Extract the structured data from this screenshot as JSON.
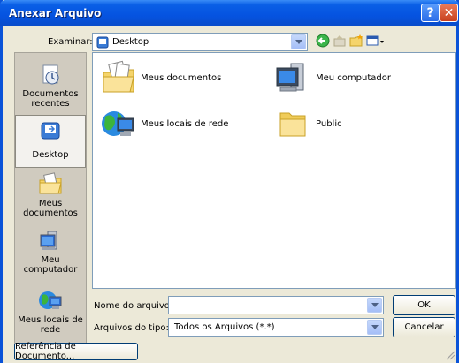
{
  "window": {
    "title": "Anexar Arquivo"
  },
  "look_in": {
    "label": "Examinar:",
    "value": "Desktop"
  },
  "toolbar": {
    "icons": [
      "back-icon",
      "up-folder-icon",
      "new-folder-icon",
      "view-menu-icon"
    ]
  },
  "places": [
    {
      "label_line1": "Documentos",
      "label_line2": "recentes",
      "icon": "recent-documents-icon"
    },
    {
      "label_line1": "Desktop",
      "label_line2": "",
      "icon": "desktop-icon"
    },
    {
      "label_line1": "Meus",
      "label_line2": "documentos",
      "icon": "my-documents-icon"
    },
    {
      "label_line1": "Meu computador",
      "label_line2": "",
      "icon": "my-computer-icon"
    },
    {
      "label_line1": "Meus locais de",
      "label_line2": "rede",
      "icon": "network-places-icon"
    }
  ],
  "items": [
    {
      "label": "Meus documentos",
      "icon": "documents-folder-icon"
    },
    {
      "label": "Meu computador",
      "icon": "computer-icon"
    },
    {
      "label": "Meus locais de rede",
      "icon": "network-icon"
    },
    {
      "label": "Public",
      "icon": "folder-icon"
    }
  ],
  "filename": {
    "label": "Nome do arquivo:",
    "value": ""
  },
  "filetype": {
    "label": "Arquivos do tipo:",
    "value": "Todos os Arquivos (*.*)"
  },
  "buttons": {
    "ok": "OK",
    "cancel": "Cancelar",
    "doc_ref": "Referência de Documento..."
  }
}
